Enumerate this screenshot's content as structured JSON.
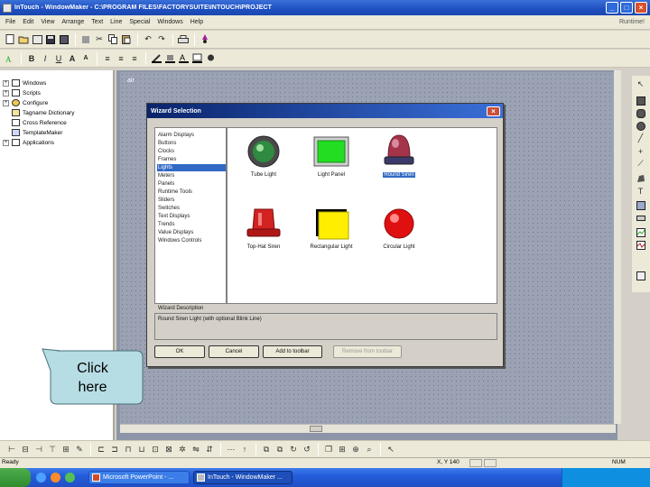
{
  "window": {
    "title": "InTouch - WindowMaker - C:\\PROGRAM FILES\\FACTORYSUITE\\INTOUCH\\PROJECT",
    "minimize": "_",
    "maximize": "□",
    "close": "×"
  },
  "menu": {
    "items": [
      "File",
      "Edit",
      "View",
      "Arrange",
      "Text",
      "Line",
      "Special",
      "Windows",
      "Help"
    ],
    "runtime": "Runtime!"
  },
  "tree": {
    "items": [
      "Windows",
      "Scripts",
      "Configure",
      "Tagname Dictionary",
      "Cross Reference",
      "TemplateMaker",
      "Applications"
    ]
  },
  "canvas": {
    "label": "air"
  },
  "dialog": {
    "title": "Wizard Selection",
    "categories": [
      "Alarm Displays",
      "Buttons",
      "Clocks",
      "Frames",
      "Lights",
      "Meters",
      "Panels",
      "Runtime Tools",
      "Sliders",
      "Switches",
      "Text Displays",
      "Trends",
      "Value Displays",
      "Windows Controls"
    ],
    "selected_category": "Lights",
    "wizards": [
      "Tube Light",
      "Light Panel",
      "Round Siren",
      "Top-Hat Siren",
      "Rectangular Light",
      "Circular Light"
    ],
    "selected_wizard": "Round Siren",
    "description_label": "Wizard Description",
    "description": "Round Siren Light (with optional Blink Line)",
    "buttons": {
      "ok": "OK",
      "cancel": "Cancel",
      "add": "Add to toolbar",
      "remove": "Remove from toolbar"
    }
  },
  "callout": {
    "line1": "Click",
    "line2": "here"
  },
  "statusbar": {
    "ready": "Ready",
    "coords": "X, Y  140",
    "num": "NUM"
  },
  "taskbar": {
    "task1": "Microsoft PowerPoint - ...",
    "task2": "InTouch - WindowMaker ..."
  },
  "colors": {
    "title_blue": "#1e4fc0",
    "selection": "#316ac5",
    "callout_fill": "#b7dde4",
    "siren_dark": "#a3344a",
    "top_hat_red": "#d32222",
    "light_green": "#22dd22",
    "rect_yellow": "#ffee00"
  }
}
